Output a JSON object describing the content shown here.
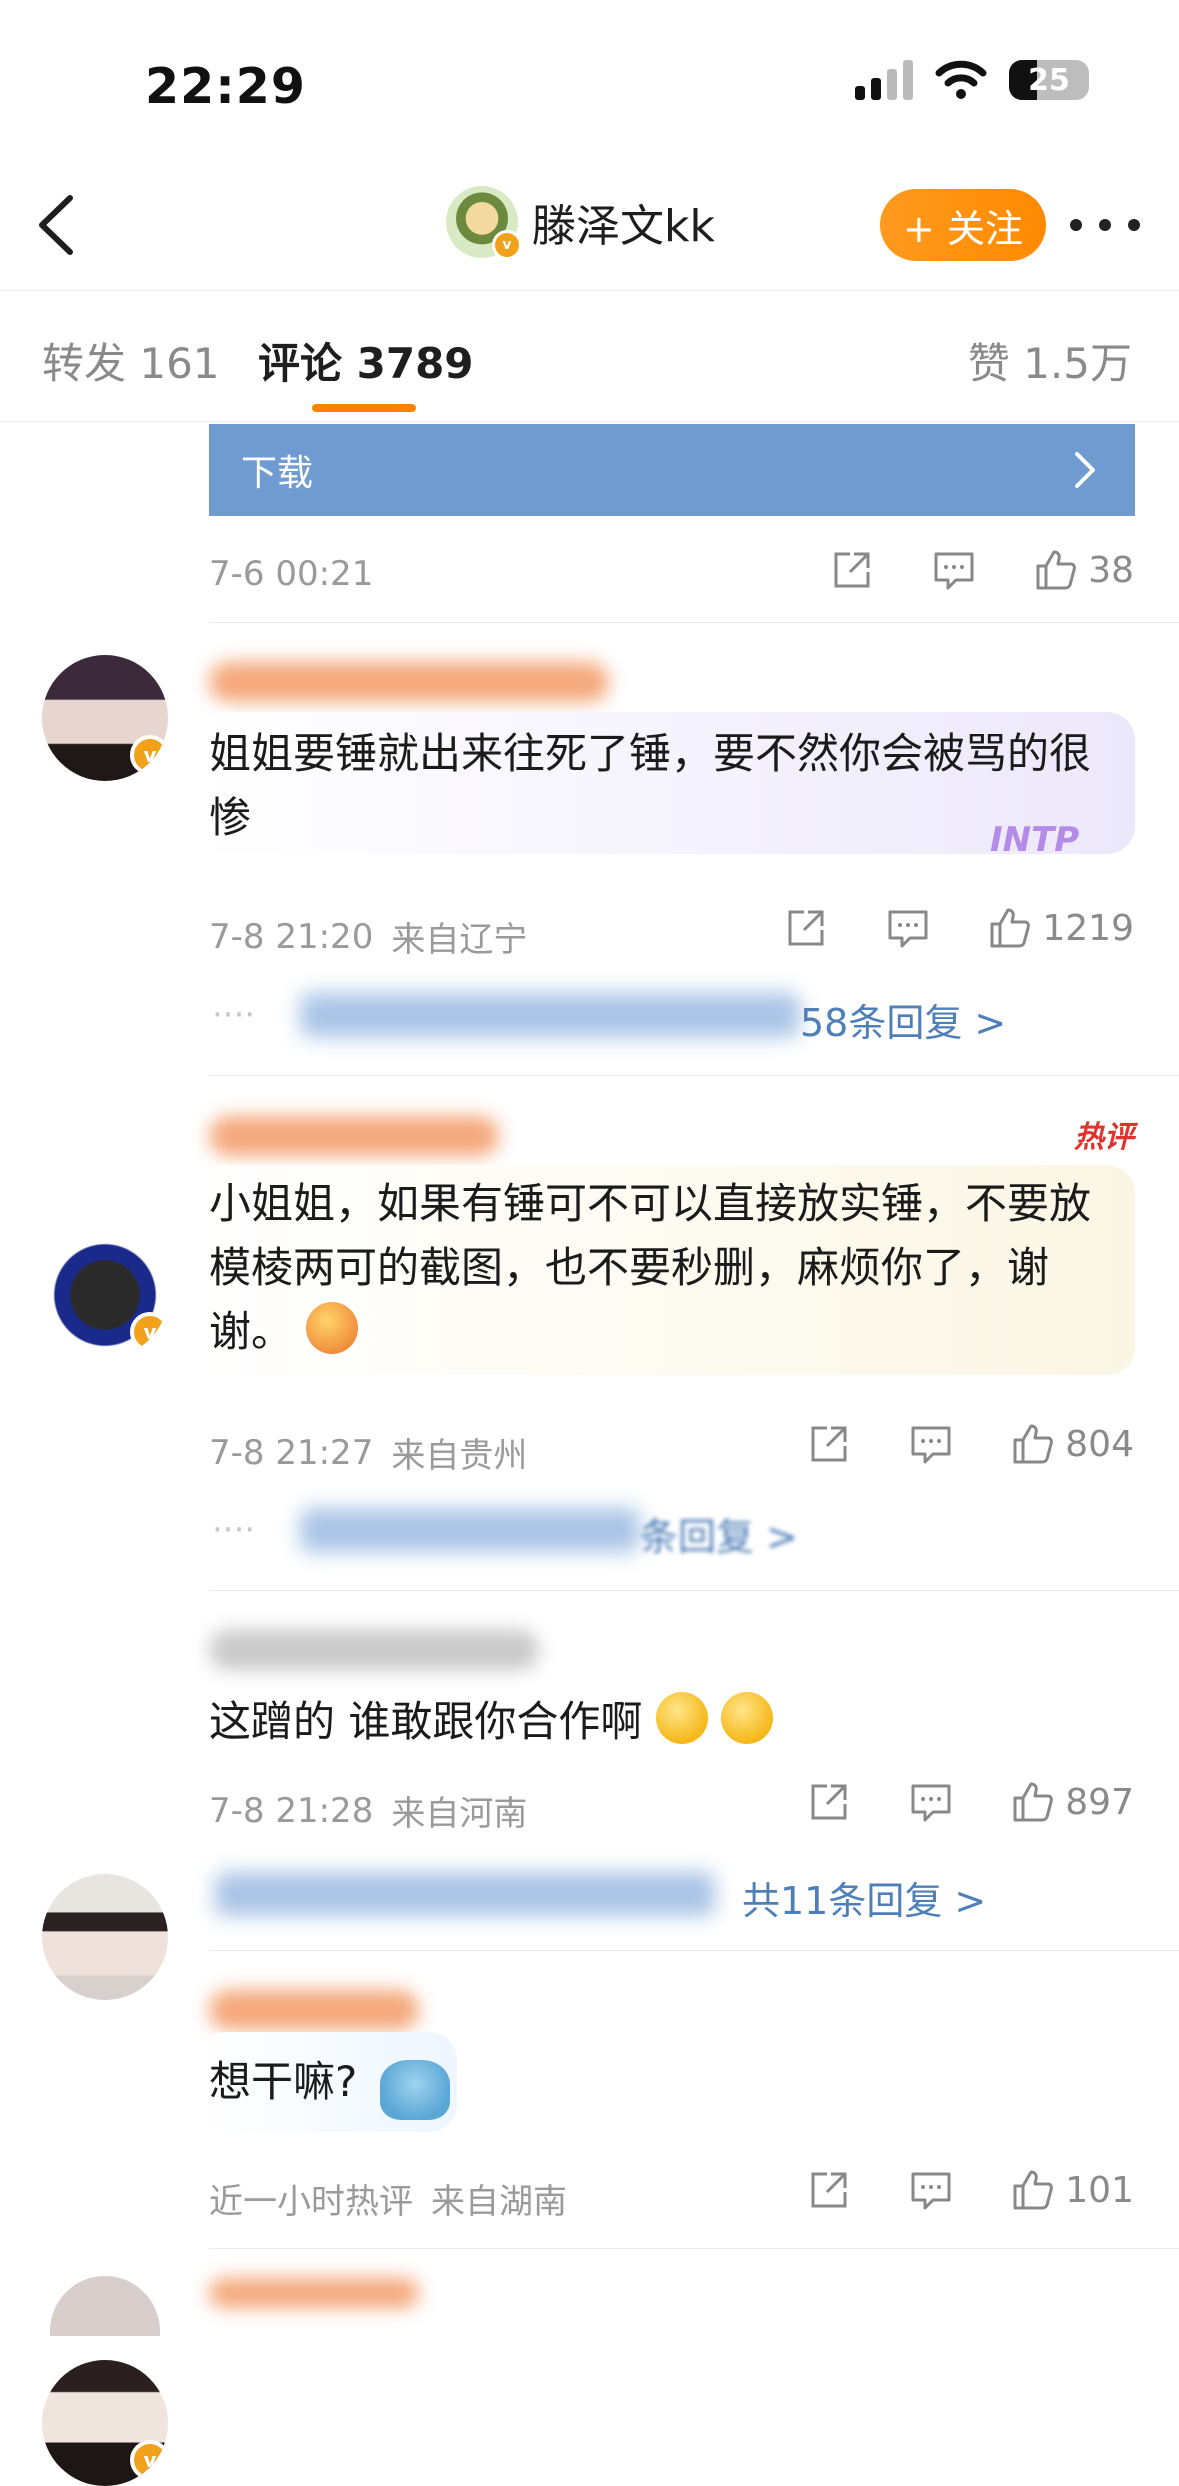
{
  "status_bar": {
    "time": "22:29",
    "battery": "25"
  },
  "header": {
    "username": "滕泽文kk",
    "follow_label": "+ 关注"
  },
  "tabs": [
    {
      "label": "转发 161"
    },
    {
      "label": "评论 3789"
    },
    {
      "label": "赞 1.5万"
    }
  ],
  "banner": {
    "label": "下载"
  },
  "top_meta": {
    "time": "7-6 00:21",
    "likes": "38"
  },
  "comments": [
    {
      "text": "姐姐要锤就出来往死了锤，要不然你会被骂的很惨",
      "time": "7-8 21:20",
      "location": "来自辽宁",
      "likes": "1219",
      "replies": "58条回复 >",
      "sticker": "INTP"
    },
    {
      "text": "小姐姐，如果有锤可不可以直接放实锤，不要放模棱两可的截图，也不要秒删，麻烦你了，谢谢。",
      "time": "7-8 21:27",
      "location": "来自贵州",
      "likes": "804",
      "replies": "条回复 >",
      "hot_label": "热评"
    },
    {
      "text": "这蹭的 谁敢跟你合作啊",
      "time": "7-8 21:28",
      "location": "来自河南",
      "likes": "897",
      "replies": "共11条回复 >"
    },
    {
      "text": "想干嘛?",
      "time": "近一小时热评",
      "location": "来自湖南",
      "likes": "101"
    }
  ],
  "colors": {
    "accent": "#ff8200",
    "link": "#4f7fb8",
    "banner": "#6f9bd0"
  }
}
